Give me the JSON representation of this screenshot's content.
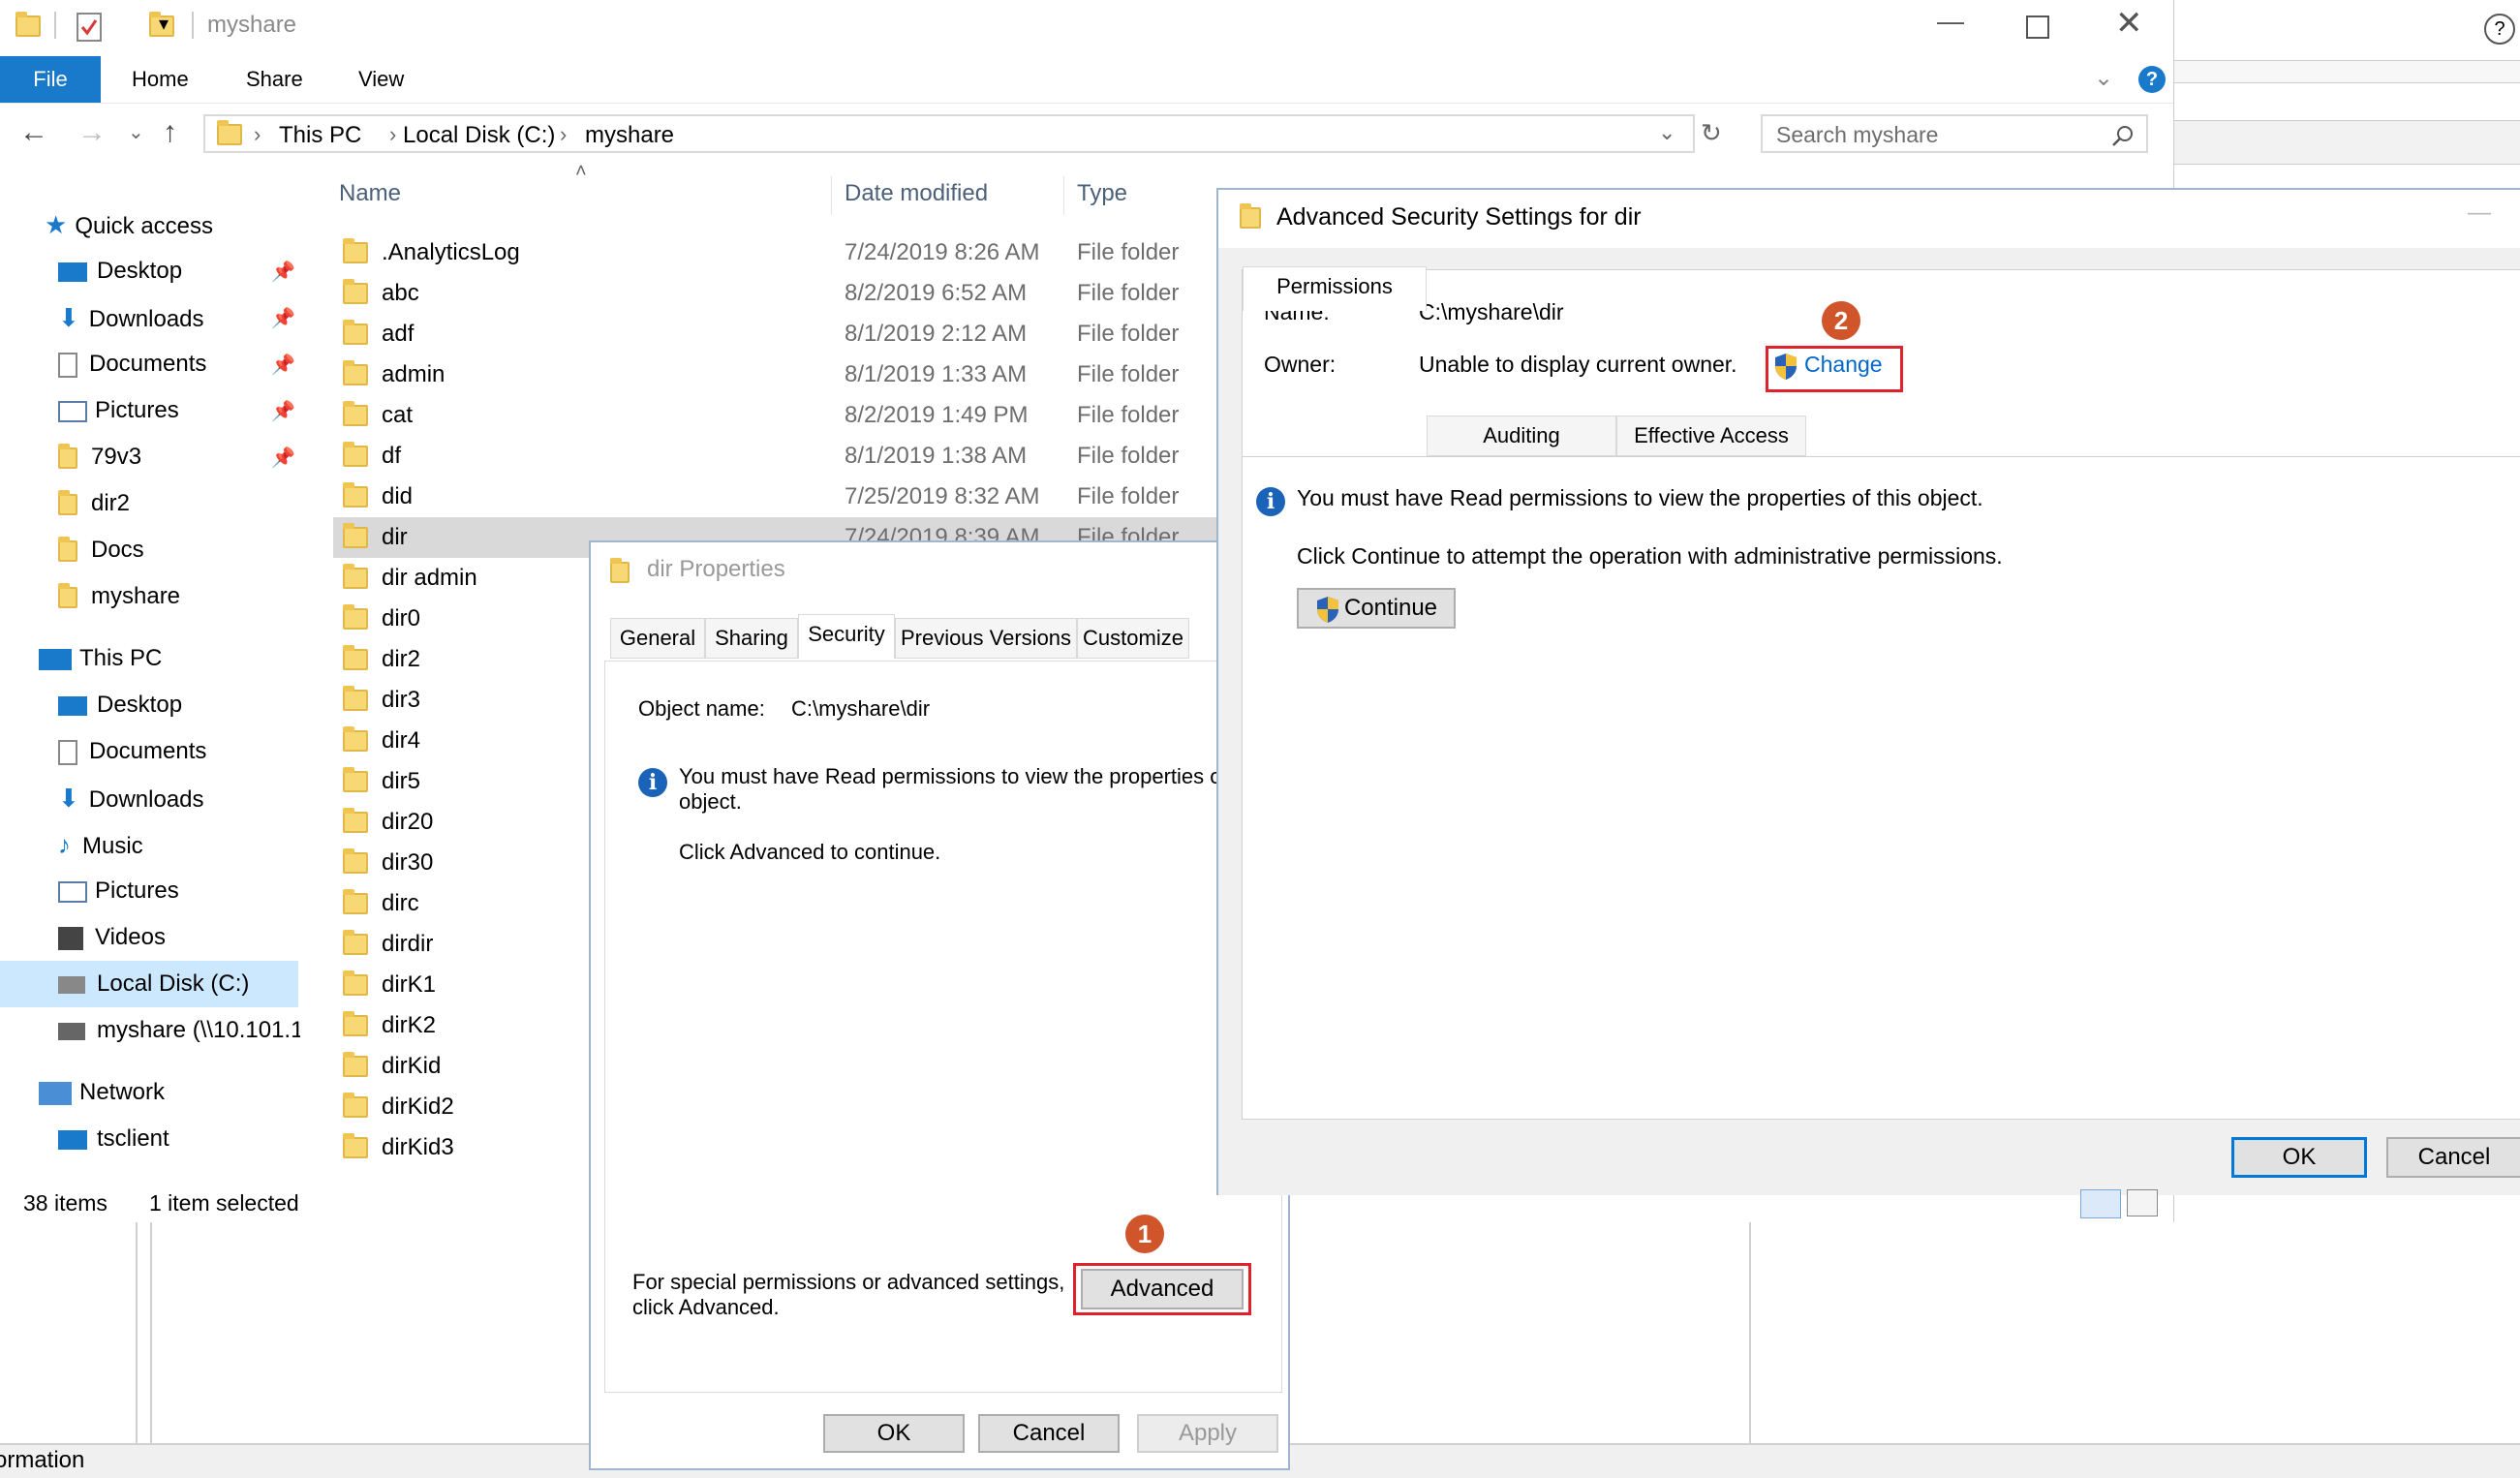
{
  "explorer": {
    "title": "myshare",
    "ribbon_tabs": [
      "File",
      "Home",
      "Share",
      "View"
    ],
    "breadcrumb": [
      "This PC",
      "Local Disk (C:)",
      "myshare"
    ],
    "search_placeholder": "Search myshare",
    "columns": {
      "name": "Name",
      "date": "Date modified",
      "type": "Type"
    },
    "nav": {
      "quick_access": "Quick access",
      "quick_items": [
        "Desktop",
        "Downloads",
        "Documents",
        "Pictures",
        "79v3",
        "dir2",
        "Docs",
        "myshare"
      ],
      "this_pc": "This PC",
      "pc_items": [
        "Desktop",
        "Documents",
        "Downloads",
        "Music",
        "Pictures",
        "Videos",
        "Local Disk (C:)",
        "myshare (\\\\10.101.1"
      ],
      "network": "Network",
      "network_items": [
        "tsclient"
      ]
    },
    "files": [
      {
        "name": ".AnalyticsLog",
        "date": "7/24/2019 8:26 AM",
        "type": "File folder"
      },
      {
        "name": "abc",
        "date": "8/2/2019 6:52 AM",
        "type": "File folder"
      },
      {
        "name": "adf",
        "date": "8/1/2019 2:12 AM",
        "type": "File folder"
      },
      {
        "name": "admin",
        "date": "8/1/2019 1:33 AM",
        "type": "File folder"
      },
      {
        "name": "cat",
        "date": "8/2/2019 1:49 PM",
        "type": "File folder"
      },
      {
        "name": "df",
        "date": "8/1/2019 1:38 AM",
        "type": "File folder"
      },
      {
        "name": "did",
        "date": "7/25/2019 8:32 AM",
        "type": "File folder"
      },
      {
        "name": "dir",
        "date": "7/24/2019 8:39 AM",
        "type": "File folder"
      },
      {
        "name": "dir admin",
        "date": "",
        "type": ""
      },
      {
        "name": "dir0",
        "date": "",
        "type": ""
      },
      {
        "name": "dir2",
        "date": "",
        "type": ""
      },
      {
        "name": "dir3",
        "date": "",
        "type": ""
      },
      {
        "name": "dir4",
        "date": "",
        "type": ""
      },
      {
        "name": "dir5",
        "date": "",
        "type": ""
      },
      {
        "name": "dir20",
        "date": "",
        "type": ""
      },
      {
        "name": "dir30",
        "date": "",
        "type": ""
      },
      {
        "name": "dirc",
        "date": "",
        "type": ""
      },
      {
        "name": "dirdir",
        "date": "",
        "type": ""
      },
      {
        "name": "dirK1",
        "date": "",
        "type": ""
      },
      {
        "name": "dirK2",
        "date": "",
        "type": ""
      },
      {
        "name": "dirKid",
        "date": "",
        "type": ""
      },
      {
        "name": "dirKid2",
        "date": "",
        "type": ""
      },
      {
        "name": "dirKid3",
        "date": "",
        "type": ""
      }
    ],
    "status": {
      "items": "38 items",
      "selected": "1 item selected"
    },
    "bottom_fragment": "ormation"
  },
  "props": {
    "title": "dir Properties",
    "tabs": [
      "General",
      "Sharing",
      "Security",
      "Previous Versions",
      "Customize"
    ],
    "object_label": "Object name:",
    "object_value": "C:\\myshare\\dir",
    "msg1": "You must have Read permissions to view the properties of th",
    "msg1b": "object.",
    "msg2": "Click Advanced to continue.",
    "special1": "For special permissions or advanced settings,",
    "special2": "click Advanced.",
    "advanced": "Advanced",
    "ok": "OK",
    "cancel": "Cancel",
    "apply": "Apply",
    "badge": "1"
  },
  "adv": {
    "title": "Advanced Security Settings for dir",
    "name_label": "Name:",
    "name_value": "C:\\myshare\\dir",
    "owner_label": "Owner:",
    "owner_value": "Unable to display current owner.",
    "change": "Change",
    "badge": "2",
    "tabs": [
      "Permissions",
      "Auditing",
      "Effective Access"
    ],
    "msg1": "You must have Read permissions to view the properties of this object.",
    "msg2": "Click Continue to attempt the operation with administrative permissions.",
    "continue": "Continue",
    "ok": "OK",
    "cancel": "Cancel"
  }
}
